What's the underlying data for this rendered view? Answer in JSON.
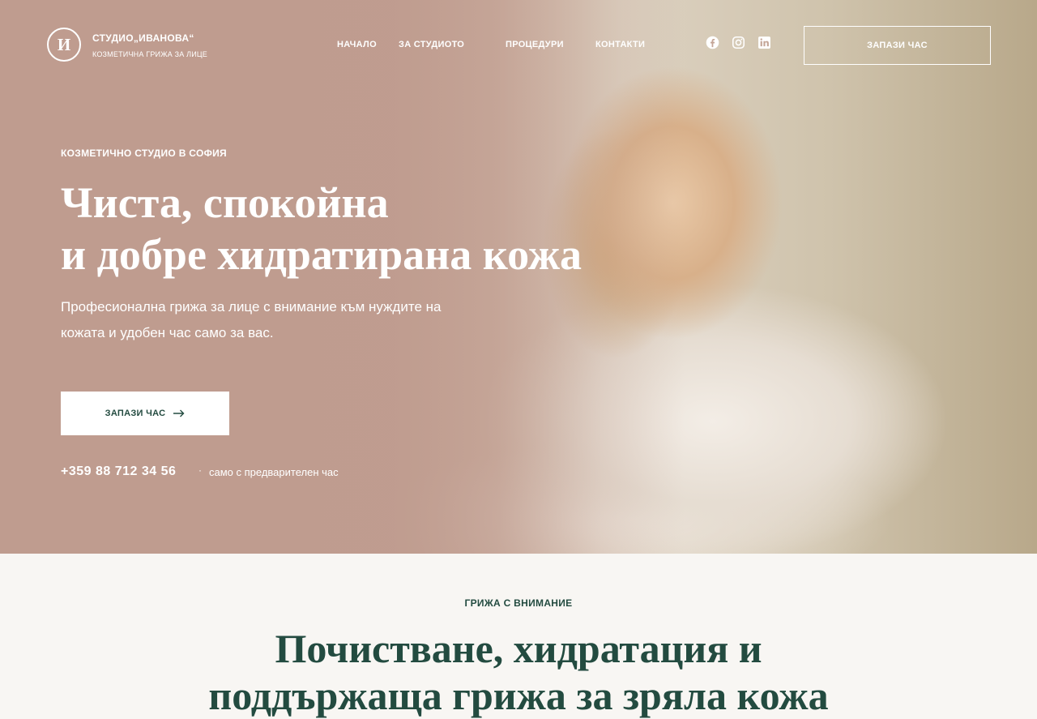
{
  "brand": {
    "mark": "И",
    "name": "СТУДИО„ИВАНОВА“",
    "tagline": "КОЗМЕТИЧНА ГРИЖА ЗА ЛИЦЕ"
  },
  "nav": {
    "items": [
      {
        "label": "НАЧАЛО"
      },
      {
        "label": "ЗА СТУДИОТО"
      },
      {
        "label": "ПРОЦЕДУРИ"
      },
      {
        "label": "КОНТАКТИ"
      }
    ]
  },
  "social": [
    "facebook-icon",
    "instagram-icon",
    "linkedin-icon"
  ],
  "header_cta": "ЗАПАЗИ ЧАС",
  "hero": {
    "eyebrow": "КОЗМЕТИЧНО СТУДИО В СОФИЯ",
    "title_line1": "Чиста, спокойна",
    "title_line2": "и добре хидратирана кожа",
    "lead": "Професионална грижа за лице с внимание към нуждите на кожата и удобен час само за вас.",
    "cta": "ЗАПАЗИ ЧАС",
    "phone": "+359 88 712 34 56",
    "separator": "·",
    "note": "само с предварителен час"
  },
  "section": {
    "eyebrow": "ГРИЖА С ВНИМАНИЕ",
    "title_line1": "Почистване, хидратация и",
    "title_line2": "поддържаща грижа за зряла кожа"
  },
  "colors": {
    "hero_bg": "#bf9f92",
    "accent_green": "#234b40",
    "section_bg": "#f8f6f3"
  }
}
